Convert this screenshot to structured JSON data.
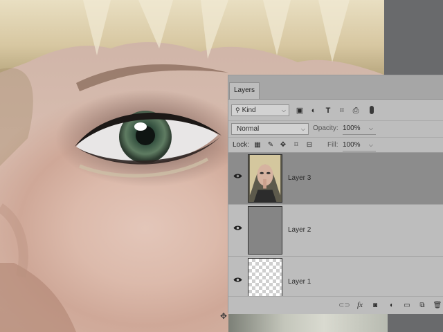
{
  "panel": {
    "tab_label": "Layers",
    "filter": {
      "kind_label": "Kind",
      "search_icon": "search-icon"
    },
    "blend_mode": "Normal",
    "opacity_label": "Opacity:",
    "opacity_value": "100%",
    "lock_label": "Lock:",
    "fill_label": "Fill:",
    "fill_value": "100%"
  },
  "layers": [
    {
      "name": "Layer 3",
      "visible": true,
      "selected": true,
      "thumbnail": "photo"
    },
    {
      "name": "Layer 2",
      "visible": true,
      "selected": false,
      "thumbnail": "gray"
    },
    {
      "name": "Layer 1",
      "visible": true,
      "selected": false,
      "thumbnail": "transparent"
    }
  ],
  "icons": {
    "filter_icons": [
      "image-filter-icon",
      "adjustment-filter-icon",
      "type-filter-icon",
      "shape-filter-icon",
      "smart-object-filter-icon"
    ],
    "lock_icons": [
      "lock-transparent-pixels-icon",
      "lock-image-pixels-icon",
      "lock-position-icon",
      "lock-artboard-icon",
      "lock-all-icon"
    ],
    "bottom_icons": [
      "link-layers-icon",
      "layer-style-icon",
      "add-mask-icon",
      "new-adjustment-layer-icon",
      "new-group-icon",
      "new-layer-icon",
      "delete-layer-icon"
    ]
  },
  "colors": {
    "panel_bg": "#bdbdbd",
    "selected_layer": "#8c8c8c",
    "tab_bar": "#a6a6a6"
  }
}
